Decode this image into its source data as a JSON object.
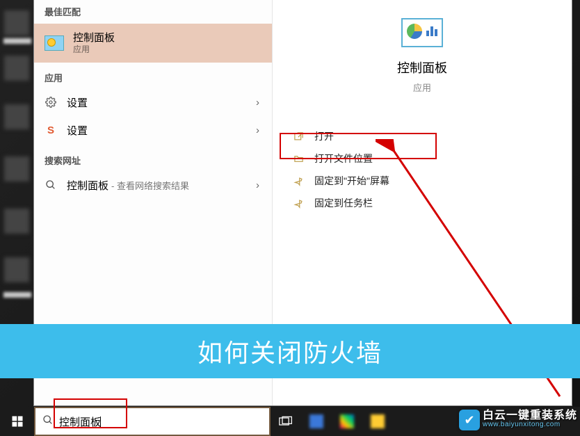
{
  "left": {
    "best_match_header": "最佳匹配",
    "best_match": {
      "title": "控制面板",
      "subtitle": "应用"
    },
    "apps_header": "应用",
    "rows": [
      {
        "label": "设置"
      },
      {
        "label": "设置"
      }
    ],
    "web_header": "搜索网址",
    "web_row": {
      "label": "控制面板",
      "suffix": "- 查看网络搜索结果"
    }
  },
  "preview": {
    "title": "控制面板",
    "subtitle": "应用"
  },
  "actions": [
    {
      "label": "打开"
    },
    {
      "label": "打开文件位置"
    },
    {
      "label": "固定到\"开始\"屏幕"
    },
    {
      "label": "固定到任务栏"
    }
  ],
  "banner": "如何关闭防火墙",
  "search": {
    "text": "控制面板"
  },
  "watermark": {
    "main": "白云一键重装系统",
    "sub": "www.baiyunxitong.com"
  }
}
